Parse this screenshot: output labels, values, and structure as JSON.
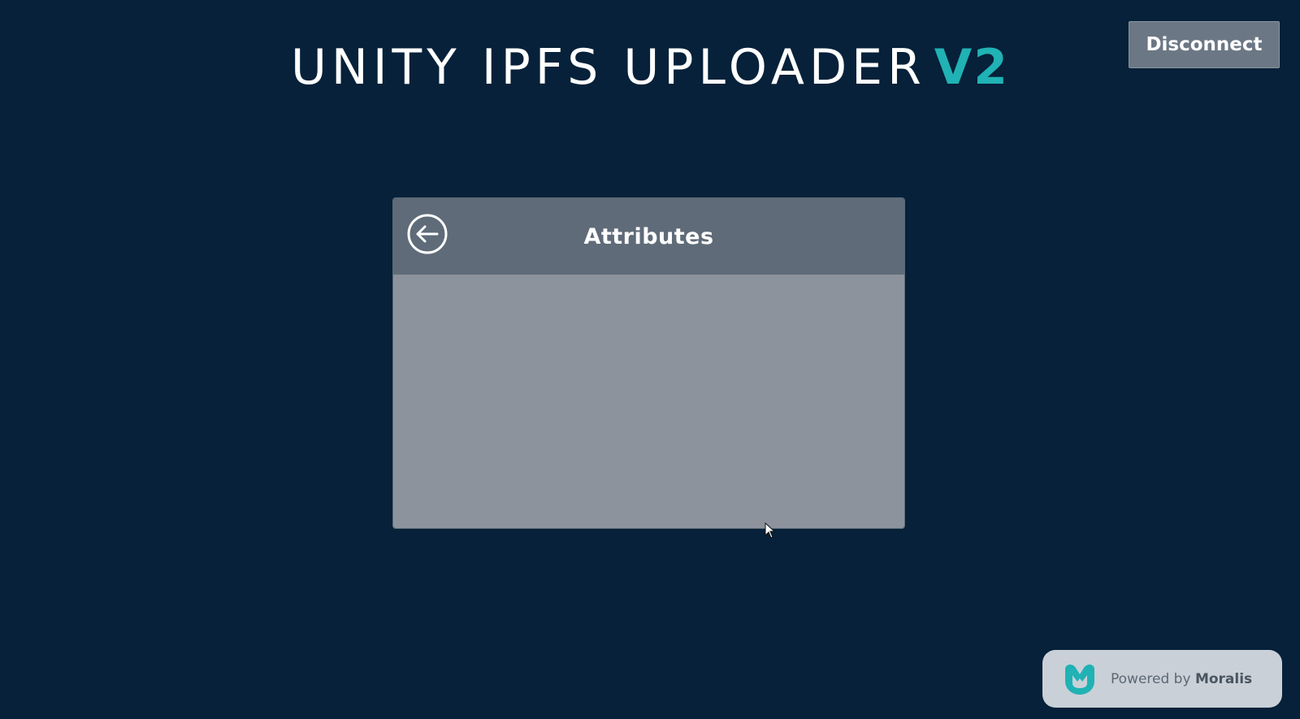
{
  "header": {
    "title_main": "UNITY IPFS UPLOADER",
    "title_accent": "V2"
  },
  "toolbar": {
    "disconnect_label": "Disconnect"
  },
  "panel": {
    "title": "Attributes",
    "back_icon": "back-arrow-icon"
  },
  "footer": {
    "powered_prefix": "Powered by",
    "powered_brand": "Moralis",
    "logo_icon": "moralis-logo-icon"
  },
  "colors": {
    "background": "#062139",
    "accent": "#20b2b4",
    "panel_header": "#5f6b78",
    "panel_body": "#8c939c",
    "button": "#6b7784"
  }
}
